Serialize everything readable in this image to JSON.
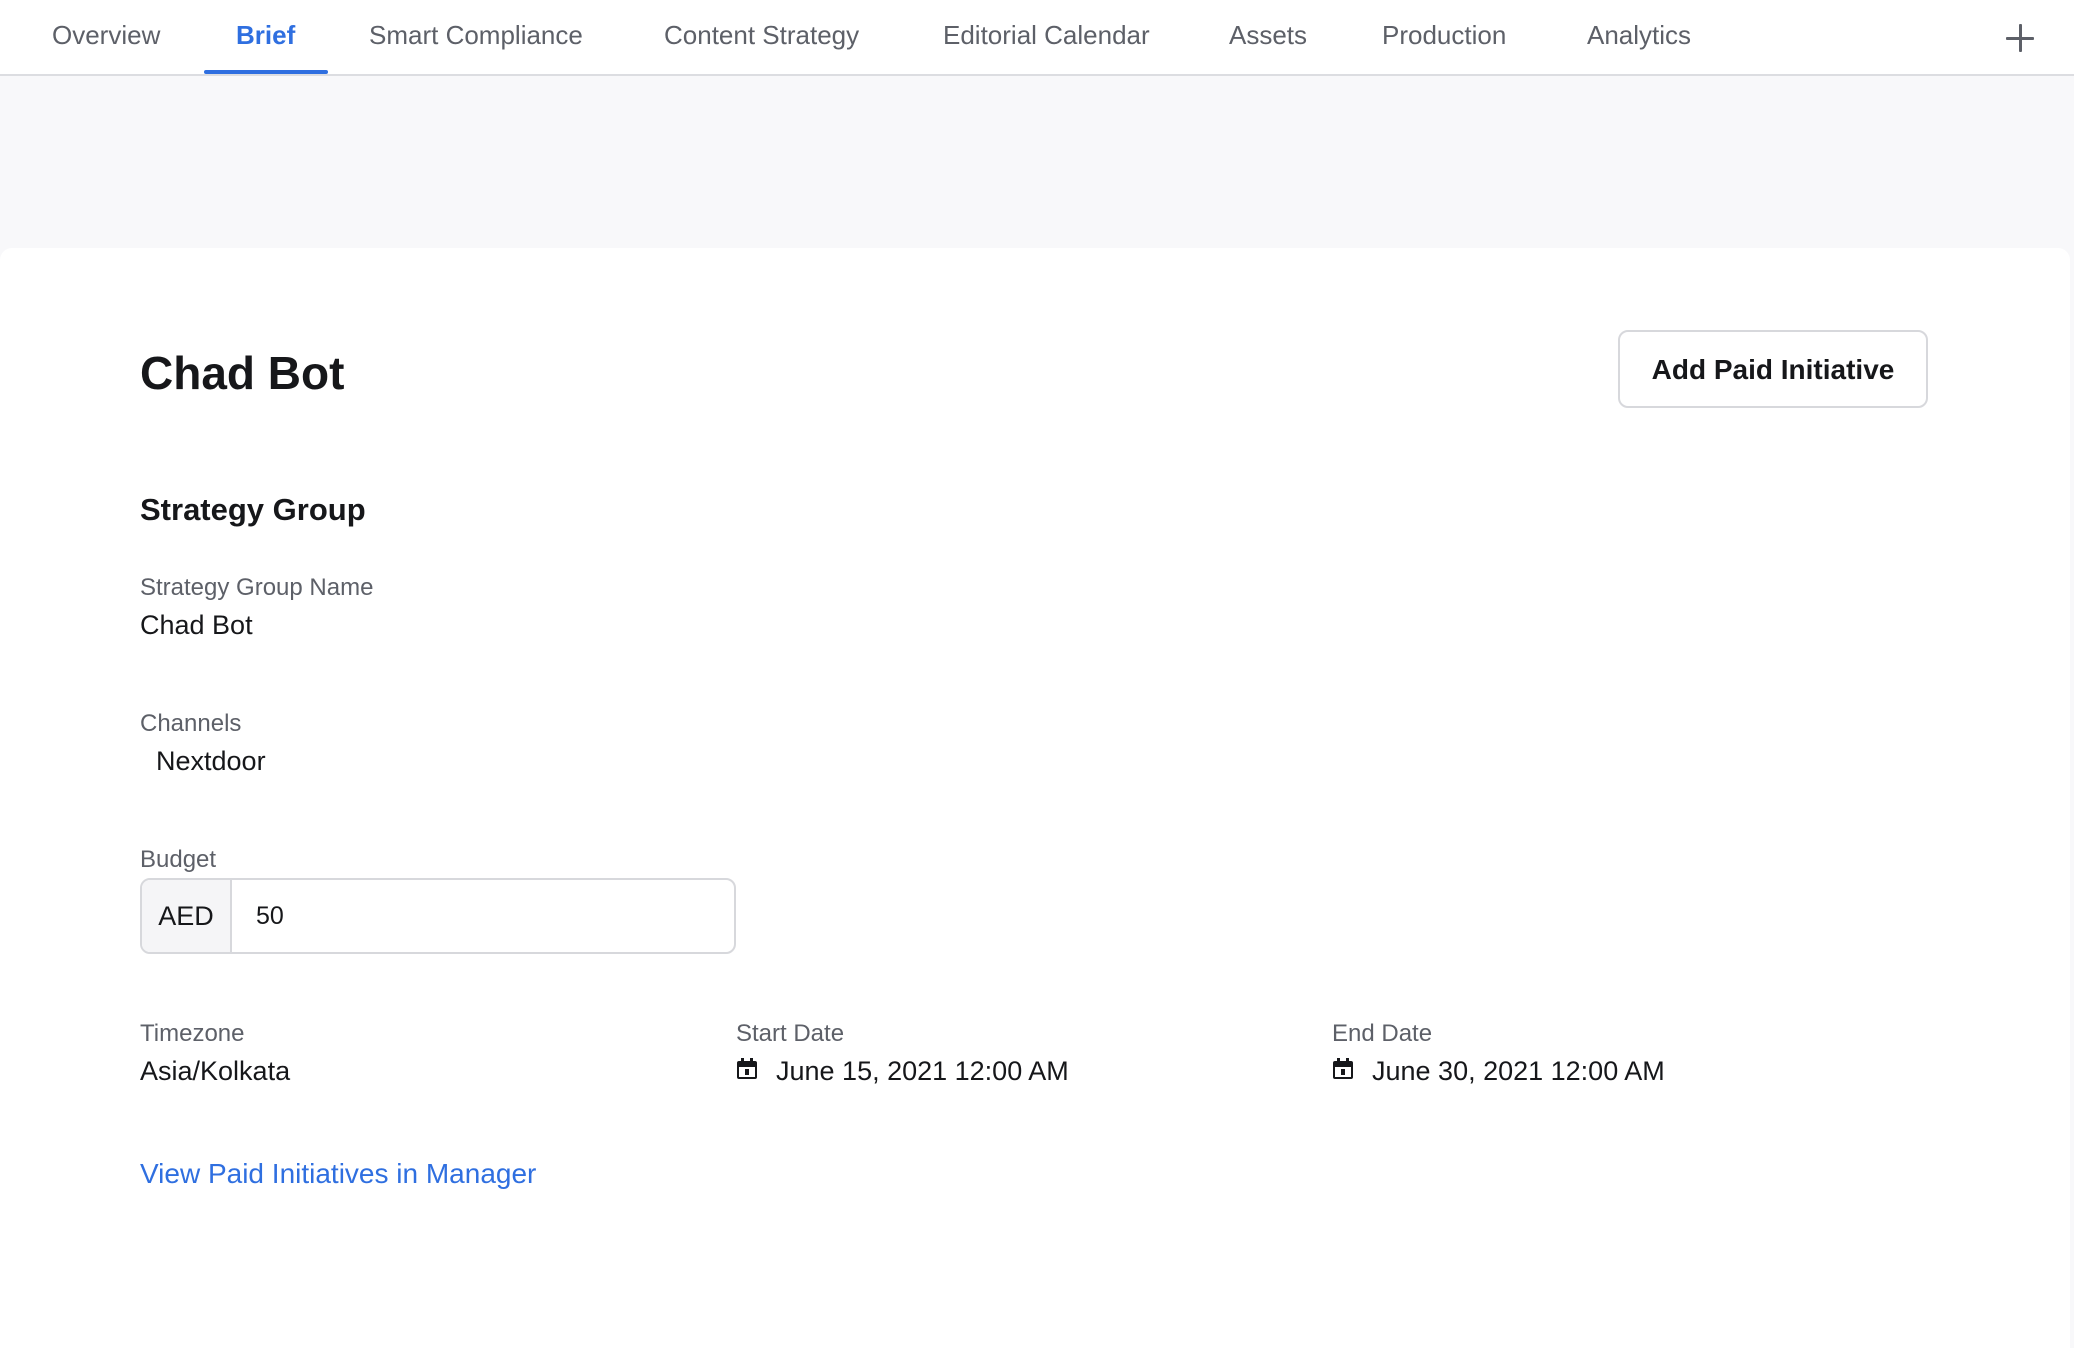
{
  "tabs": [
    {
      "label": "Overview"
    },
    {
      "label": "Brief",
      "active": true
    },
    {
      "label": "Smart Compliance"
    },
    {
      "label": "Content Strategy"
    },
    {
      "label": "Editorial Calendar"
    },
    {
      "label": "Assets"
    },
    {
      "label": "Production"
    },
    {
      "label": "Analytics"
    }
  ],
  "header": {
    "title": "Chad Bot",
    "add_button_label": "Add Paid Initiative"
  },
  "strategy_group": {
    "section_title": "Strategy Group",
    "name_label": "Strategy Group Name",
    "name_value": "Chad Bot",
    "channels_label": "Channels",
    "channels_value": "Nextdoor",
    "budget_label": "Budget",
    "budget_currency": "AED",
    "budget_value": "50",
    "timezone_label": "Timezone",
    "timezone_value": "Asia/Kolkata",
    "start_date_label": "Start Date",
    "start_date_value": "June 15, 2021 12:00 AM",
    "end_date_label": "End Date",
    "end_date_value": "June 30, 2021 12:00 AM",
    "manager_link": "View Paid Initiatives in Manager"
  },
  "colors": {
    "accent": "#2f6fe0",
    "muted_text": "#5d6068",
    "primary_text": "#16171a",
    "background": "#f8f8fa"
  },
  "icons": {
    "add_tab": "plus-icon",
    "date": "calendar-icon"
  }
}
